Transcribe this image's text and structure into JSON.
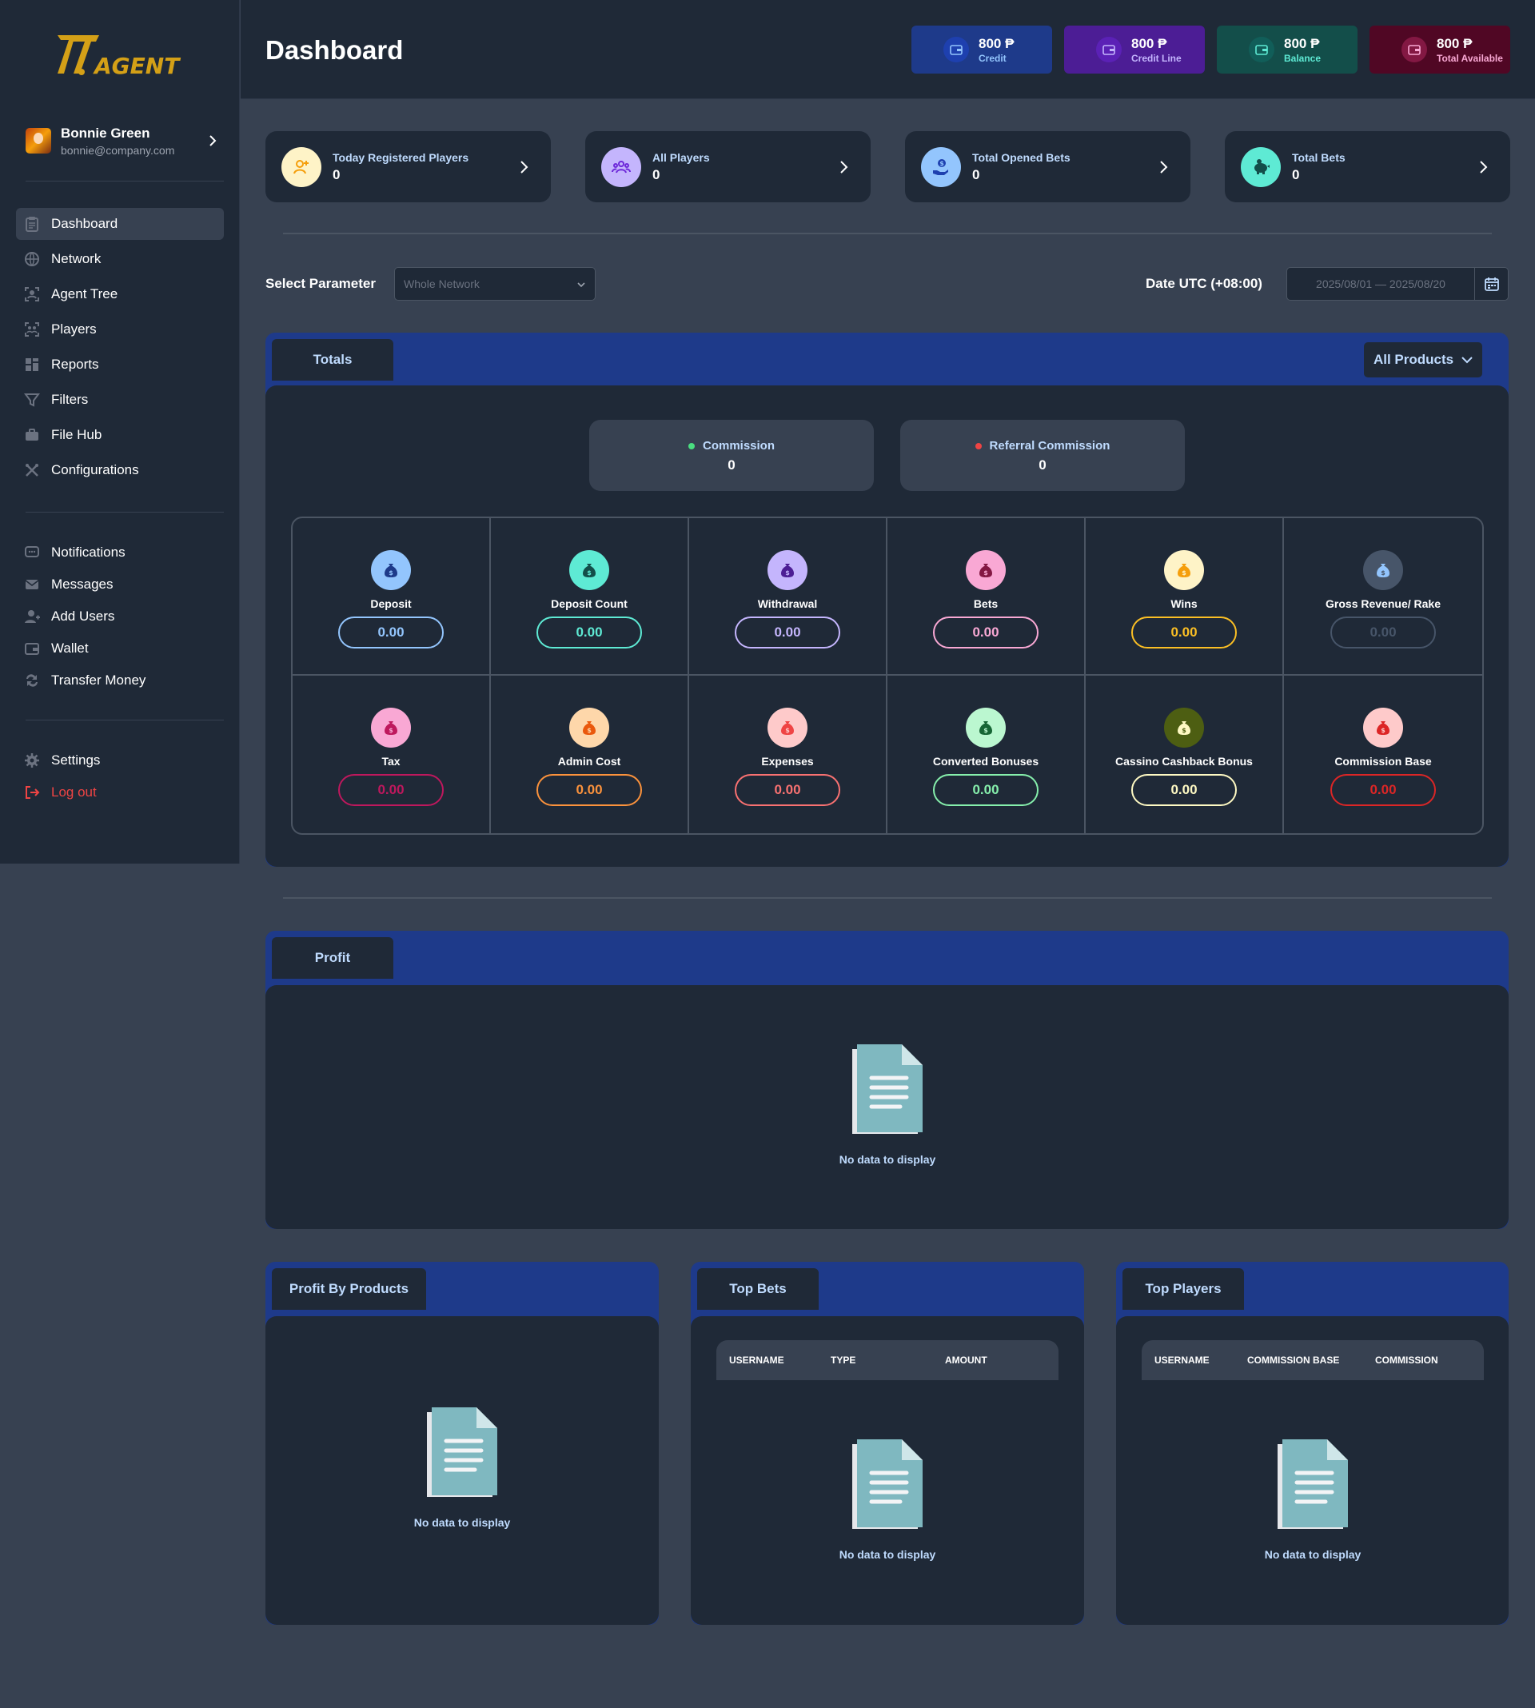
{
  "app": {
    "logo_text": "747.AGENT"
  },
  "user": {
    "name": "Bonnie Green",
    "email": "bonnie@company.com"
  },
  "nav": {
    "main": [
      {
        "label": "Dashboard",
        "icon": "clipboard-icon",
        "active": true
      },
      {
        "label": "Network",
        "icon": "globe-icon"
      },
      {
        "label": "Agent Tree",
        "icon": "agent-tree-icon"
      },
      {
        "label": "Players",
        "icon": "players-icon"
      },
      {
        "label": "Reports",
        "icon": "reports-icon"
      },
      {
        "label": "Filters",
        "icon": "filter-icon"
      },
      {
        "label": "File Hub",
        "icon": "briefcase-icon"
      },
      {
        "label": "Configurations",
        "icon": "tools-icon"
      }
    ],
    "secondary": [
      {
        "label": "Notifications",
        "icon": "chat-icon"
      },
      {
        "label": "Messages",
        "icon": "envelope-icon"
      },
      {
        "label": "Add Users",
        "icon": "user-add-icon"
      },
      {
        "label": "Wallet",
        "icon": "wallet-icon"
      },
      {
        "label": "Transfer Money",
        "icon": "transfer-icon"
      }
    ],
    "settings": {
      "label": "Settings",
      "icon": "gear-icon"
    },
    "logout": {
      "label": "Log out",
      "icon": "logout-icon"
    }
  },
  "header": {
    "title": "Dashboard",
    "chips": [
      {
        "value": "800 ₱",
        "label": "Credit",
        "bg": "#1e3a8a",
        "icon_bg": "#1e40af",
        "color": "#93c5fd"
      },
      {
        "value": "800 ₱",
        "label": "Credit Line",
        "bg": "#4c1d95",
        "icon_bg": "#5b21b6",
        "color": "#c4b5fd"
      },
      {
        "value": "800 ₱",
        "label": "Balance",
        "bg": "#134e4a",
        "icon_bg": "#115e59",
        "color": "#5eead4"
      },
      {
        "value": "800 ₱",
        "label": "Total Available",
        "bg": "#500724",
        "icon_bg": "#831843",
        "color": "#f9a8d4"
      }
    ]
  },
  "summary": [
    {
      "label": "Today Registered Players",
      "value": "0",
      "icon": "user-plus-icon",
      "icon_bg": "#fef3c7",
      "icon_color": "#f59e0b"
    },
    {
      "label": "All Players",
      "value": "0",
      "icon": "group-icon",
      "icon_bg": "#c4b5fd",
      "icon_color": "#6d28d9"
    },
    {
      "label": "Total Opened Bets",
      "value": "0",
      "icon": "hand-coin-icon",
      "icon_bg": "#93c5fd",
      "icon_color": "#1e40af"
    },
    {
      "label": "Total Bets",
      "value": "0",
      "icon": "piggy-bank-icon",
      "icon_bg": "#5eead4",
      "icon_color": "#134e4a"
    }
  ],
  "filters": {
    "parameter_label": "Select Parameter",
    "parameter_value": "Whole Network",
    "date_label": "Date UTC (+08:00)",
    "date_value": "2025/08/01 — 2025/08/20"
  },
  "totals": {
    "tab": "Totals",
    "products_button": "All Products",
    "commission": {
      "label": "Commission",
      "value": "0",
      "dot": "#4ade80"
    },
    "referral": {
      "label": "Referral Commission",
      "value": "0",
      "dot": "#ef4444"
    },
    "cells": [
      {
        "label": "Deposit",
        "value": "0.00",
        "icon_bg": "#93c5fd",
        "icon_fg": "#1e3a8a",
        "border": "#93c5fd",
        "text": "#93c5fd"
      },
      {
        "label": "Deposit Count",
        "value": "0.00",
        "icon_bg": "#5eead4",
        "icon_fg": "#134e4a",
        "border": "#5eead4",
        "text": "#5eead4"
      },
      {
        "label": "Withdrawal",
        "value": "0.00",
        "icon_bg": "#c4b5fd",
        "icon_fg": "#4c1d95",
        "border": "#c4b5fd",
        "text": "#c4b5fd"
      },
      {
        "label": "Bets",
        "value": "0.00",
        "icon_bg": "#f9a8d4",
        "icon_fg": "#831843",
        "border": "#f9a8d4",
        "text": "#f9a8d4"
      },
      {
        "label": "Wins",
        "value": "0.00",
        "icon_bg": "#fef3c7",
        "icon_fg": "#f59e0b",
        "border": "#fbbf24",
        "text": "#fbbf24"
      },
      {
        "label": "Gross Revenue/ Rake",
        "value": "0.00",
        "icon_bg": "#475569",
        "icon_fg": "#93c5fd",
        "border": "#475569",
        "text": "#475569"
      },
      {
        "label": "Tax",
        "value": "0.00",
        "icon_bg": "#f9a8d4",
        "icon_fg": "#be185d",
        "border": "#be185d",
        "text": "#be185d"
      },
      {
        "label": "Admin Cost",
        "value": "0.00",
        "icon_bg": "#fed7aa",
        "icon_fg": "#ea580c",
        "border": "#fb923c",
        "text": "#fb923c"
      },
      {
        "label": "Expenses",
        "value": "0.00",
        "icon_bg": "#fecaca",
        "icon_fg": "#ef4444",
        "border": "#f87171",
        "text": "#f87171"
      },
      {
        "label": "Converted Bonuses",
        "value": "0.00",
        "icon_bg": "#bbf7d0",
        "icon_fg": "#166534",
        "border": "#86efac",
        "text": "#86efac"
      },
      {
        "label": "Cassino Cashback Bonus",
        "value": "0.00",
        "icon_bg": "#4d5e12",
        "icon_fg": "#fef9c3",
        "border": "#fef9c3",
        "text": "#fef9c3"
      },
      {
        "label": "Commission Base",
        "value": "0.00",
        "icon_bg": "#fecaca",
        "icon_fg": "#dc2626",
        "border": "#dc2626",
        "text": "#dc2626"
      }
    ]
  },
  "profit": {
    "tab": "Profit",
    "empty": "No data to display"
  },
  "profit_by_products": {
    "tab": "Profit By Products",
    "empty": "No data to display"
  },
  "top_bets": {
    "tab": "Top Bets",
    "columns": [
      "USERNAME",
      "TYPE",
      "AMOUNT"
    ],
    "empty": "No data to display"
  },
  "top_players": {
    "tab": "Top Players",
    "columns": [
      "USERNAME",
      "COMMISSION BASE",
      "COMMISSION"
    ],
    "empty": "No data to display"
  }
}
